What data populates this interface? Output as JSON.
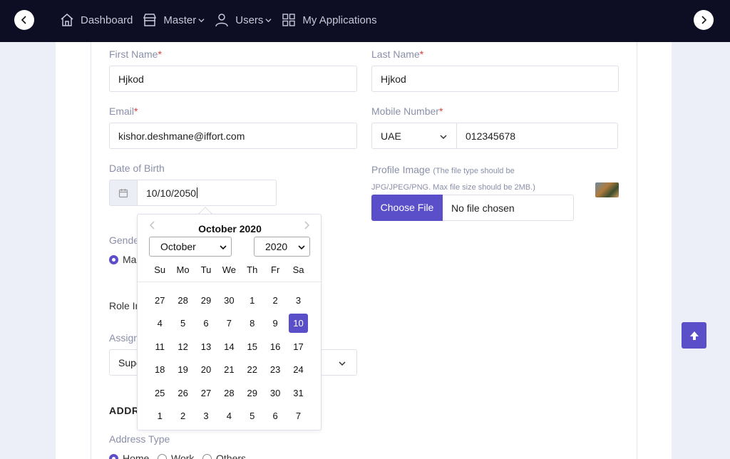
{
  "nav": {
    "items": [
      {
        "label": "Dashboard",
        "icon": "home-icon"
      },
      {
        "label": "Master",
        "icon": "store-icon"
      },
      {
        "label": "Users",
        "icon": "user-icon"
      },
      {
        "label": "My Applications",
        "icon": "grid-icon"
      }
    ]
  },
  "form": {
    "first_name": {
      "label": "First Name",
      "required": "*",
      "value": "Hjkod"
    },
    "last_name": {
      "label": "Last Name",
      "required": "*",
      "value": "Hjkod"
    },
    "email": {
      "label": "Email",
      "required": "*",
      "value": "kishor.deshmane@iffort.com"
    },
    "mobile": {
      "label": "Mobile Number",
      "required": "*",
      "country": "UAE",
      "value": "012345678"
    },
    "dob": {
      "label": "Date of Birth",
      "value": "10/10/2050"
    },
    "profile_image": {
      "label": "Profile Image",
      "hint_line1": "(The file type should be",
      "hint_line2": "JPG/JPEG/PNG. Max file size should be 2MB.)",
      "button": "Choose File",
      "file_text": "No file chosen"
    },
    "gender": {
      "label_partial": "Gende",
      "option_partial": "Ma"
    },
    "role_partial": "Role In",
    "assign": {
      "label_partial": "Assign",
      "value_partial": "Supe"
    },
    "address_heading_partial": "ADDR",
    "address_type": {
      "label": "Address Type",
      "options": [
        "Home",
        "Work",
        "Others"
      ]
    }
  },
  "datepicker": {
    "title": "October 2020",
    "month": "October",
    "year": "2020",
    "weekdays": [
      "Su",
      "Mo",
      "Tu",
      "We",
      "Th",
      "Fr",
      "Sa"
    ],
    "days": [
      "27",
      "28",
      "29",
      "30",
      "1",
      "2",
      "3",
      "4",
      "5",
      "6",
      "7",
      "8",
      "9",
      "10",
      "11",
      "12",
      "13",
      "14",
      "15",
      "16",
      "17",
      "18",
      "19",
      "20",
      "21",
      "22",
      "23",
      "24",
      "25",
      "26",
      "27",
      "28",
      "29",
      "30",
      "31",
      "1",
      "2",
      "3",
      "4",
      "5",
      "6",
      "7"
    ],
    "selected": "10"
  },
  "colors": {
    "accent": "#5a4fc9",
    "topbar": "#0d0d24",
    "required": "#e53935"
  }
}
